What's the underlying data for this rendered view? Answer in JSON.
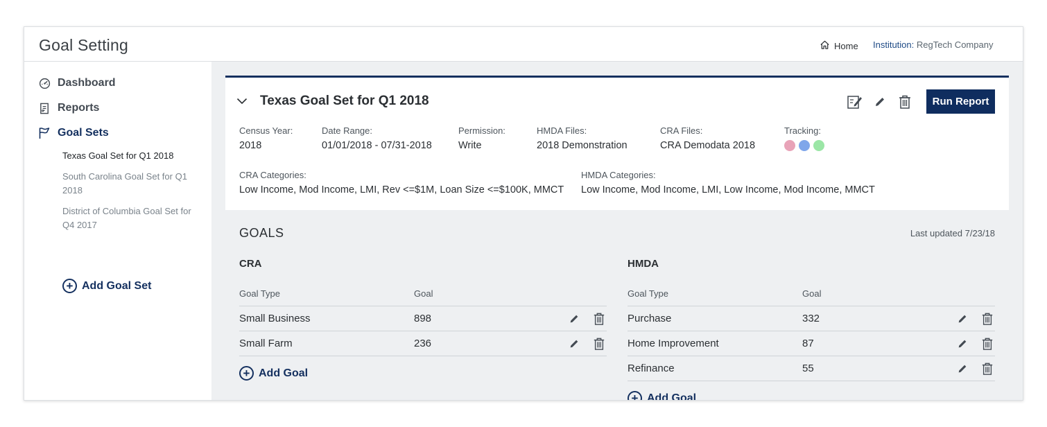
{
  "app": {
    "title": "Goal Setting",
    "home_label": "Home",
    "institution_label": "Institution:",
    "institution_name": "RegTech Company"
  },
  "sidebar": {
    "items": [
      {
        "label": "Dashboard",
        "icon": "dashboard-icon"
      },
      {
        "label": "Reports",
        "icon": "reports-icon"
      },
      {
        "label": "Goal Sets",
        "icon": "flag-icon"
      }
    ],
    "goal_sets": [
      "Texas Goal Set for Q1 2018",
      "South Carolina Goal Set for Q1 2018",
      "District of Columbia Goal Set for Q4 2017"
    ],
    "add_goal_set": "Add Goal Set"
  },
  "goal_set": {
    "title": "Texas Goal Set for Q1 2018",
    "run_report": "Run Report",
    "census_year_label": "Census Year:",
    "census_year": "2018",
    "date_range_label": "Date Range:",
    "date_range": "01/01/2018 - 07/31-2018",
    "permission_label": "Permission:",
    "permission": "Write",
    "hmda_files_label": "HMDA Files:",
    "hmda_files": "2018 Demonstration",
    "cra_files_label": "CRA Files:",
    "cra_files": "CRA Demodata 2018",
    "tracking_label": "Tracking:",
    "tracking_colors": [
      "#e8a3b8",
      "#7fa6ea",
      "#9be6a6"
    ],
    "cra_categories_label": "CRA Categories:",
    "cra_categories": "Low Income, Mod Income, LMI, Rev <=$1M, Loan Size <=$100K, MMCT",
    "hmda_categories_label": "HMDA Categories:",
    "hmda_categories": "Low Income, Mod Income, LMI, Low Income, Mod Income, MMCT"
  },
  "goals": {
    "heading": "GOALS",
    "last_updated": "Last updated 7/23/18",
    "col_type": "Goal Type",
    "col_goal": "Goal",
    "add_goal": "Add Goal",
    "cra": {
      "title": "CRA",
      "rows": [
        {
          "type": "Small Business",
          "goal": "898"
        },
        {
          "type": "Small Farm",
          "goal": "236"
        }
      ]
    },
    "hmda": {
      "title": "HMDA",
      "rows": [
        {
          "type": "Purchase",
          "goal": "332"
        },
        {
          "type": "Home Improvement",
          "goal": "87"
        },
        {
          "type": "Refinance",
          "goal": "55"
        }
      ]
    }
  }
}
